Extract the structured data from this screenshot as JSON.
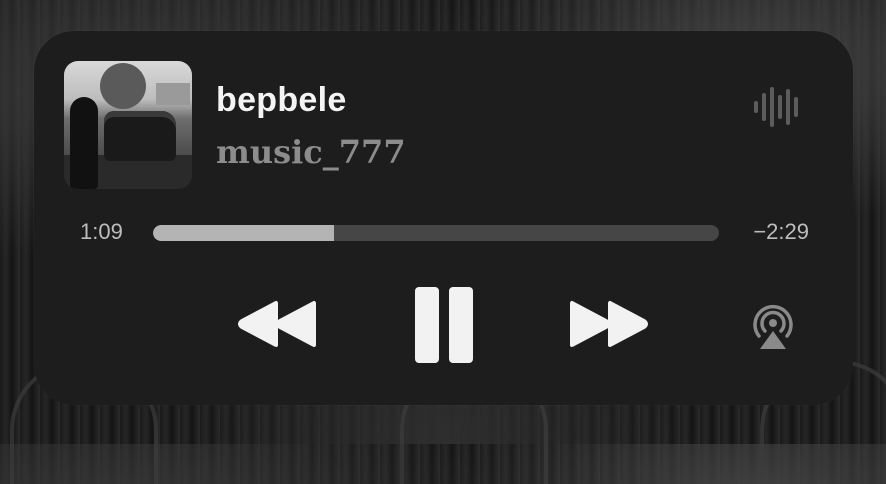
{
  "track": {
    "title": "bepbele",
    "artist": "music_777",
    "artwork_icon": "album-artwork"
  },
  "progress": {
    "elapsed": "1:09",
    "remaining": "−2:29",
    "fraction": 0.32
  },
  "controls": {
    "rewind_icon": "rewind-icon",
    "pause_icon": "pause-icon",
    "forward_icon": "fast-forward-icon",
    "airplay_icon": "airplay-icon",
    "waveform_icon": "waveform-icon"
  },
  "colors": {
    "panel": "#1d1d1d",
    "title": "#f4f4f4",
    "artist": "#8c8c8c",
    "track": "#464646",
    "fill": "#b4b4b4"
  }
}
